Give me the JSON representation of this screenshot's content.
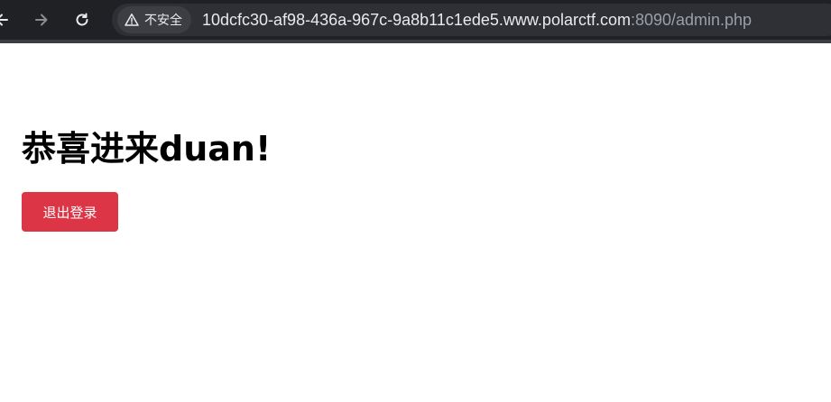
{
  "browser": {
    "security_label": "不安全",
    "url_host": "10dcfc30-af98-436a-967c-9a8b11c1ede5.www.polarctf.com",
    "url_rest": ":8090/admin.php"
  },
  "page": {
    "title": "恭喜进来duan!",
    "logout_label": "退出登录",
    "logout_color": "#dc3545"
  }
}
